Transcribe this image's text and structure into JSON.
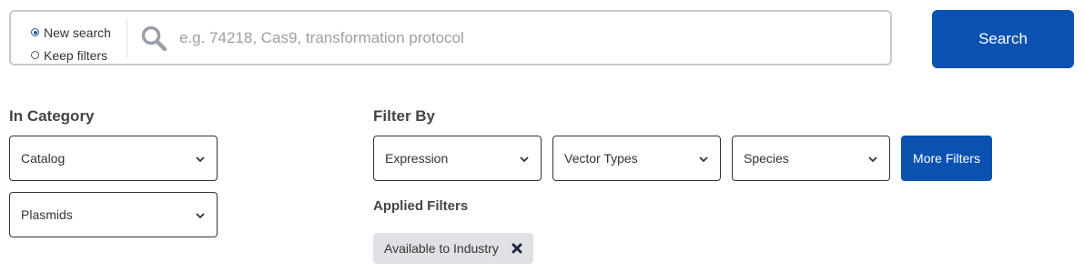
{
  "search": {
    "mode_options": [
      "New search",
      "Keep filters"
    ],
    "selected_mode": "New search",
    "placeholder": "e.g. 74218, Cas9, transformation protocol",
    "value": "",
    "button_label": "Search"
  },
  "category": {
    "heading": "In Category",
    "selects": [
      "Catalog",
      "Plasmids"
    ]
  },
  "filter_by": {
    "heading": "Filter By",
    "selects": [
      "Expression",
      "Vector Types",
      "Species"
    ],
    "more_label": "More Filters"
  },
  "applied": {
    "heading": "Applied Filters",
    "chips": [
      "Available to Industry"
    ]
  },
  "colors": {
    "accent": "#0b51b0",
    "chip_bg": "#dfe1e5"
  }
}
